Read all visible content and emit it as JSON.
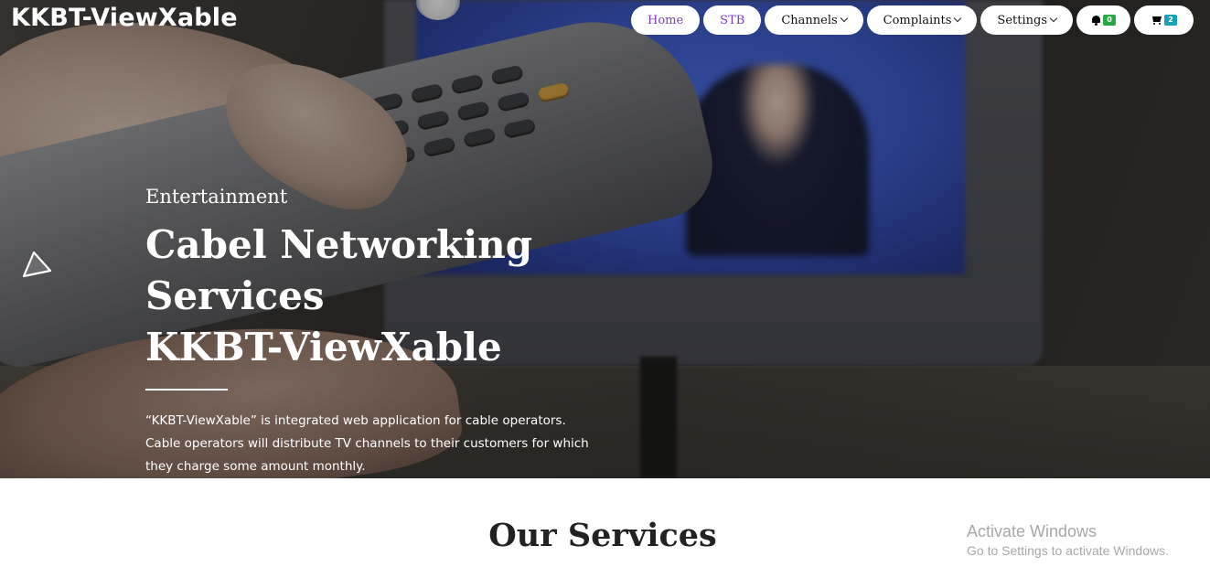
{
  "header": {
    "brand": "KKBT-ViewXable"
  },
  "nav": {
    "home": "Home",
    "stb": "STB",
    "channels": "Channels",
    "complaints": "Complaints",
    "settings": "Settings",
    "notifications_icon": "bell-icon",
    "notifications_count": "0",
    "cart_icon": "cart-icon",
    "cart_count": "2"
  },
  "hero": {
    "subtitle": "Entertainment",
    "title_line1": "Cabel Networking",
    "title_line2": "Services",
    "title_line3": "KKBT-ViewXable",
    "description": "“KKBT-ViewXable” is integrated web application for cable operators. Cable operators will distribute TV channels to their customers for which they charge some amount monthly.",
    "prev_icon": "triangle-left-arrow-icon"
  },
  "services": {
    "title": "Our Services"
  },
  "watermark": {
    "title": "Activate Windows",
    "subtitle": "Go to Settings to activate Windows."
  },
  "colors": {
    "nav_accent": "#7a3fb8",
    "badge_green": "#28a745",
    "badge_teal": "#17a2b8"
  }
}
